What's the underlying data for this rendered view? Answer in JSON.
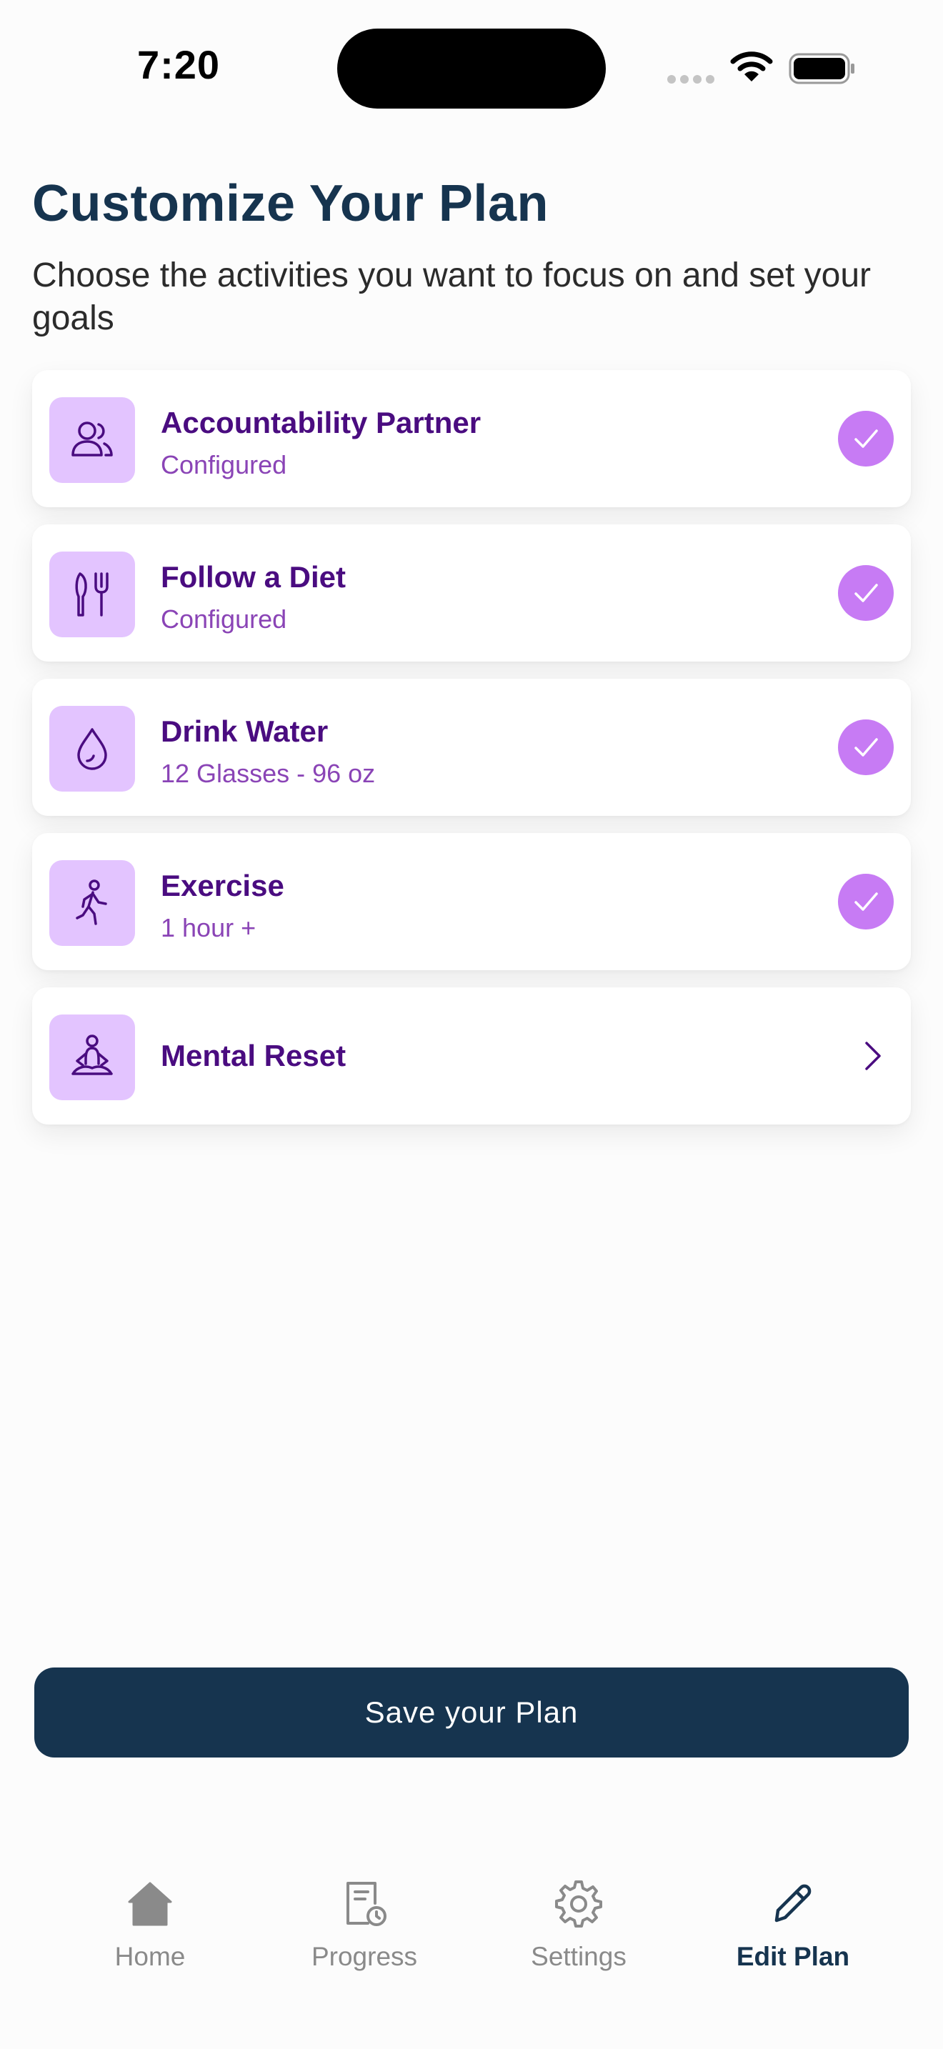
{
  "status_bar": {
    "time": "7:20"
  },
  "header": {
    "title": "Customize Your Plan",
    "subtitle": "Choose the activities you want to focus on and set your goals"
  },
  "activities": [
    {
      "title": "Accountability Partner",
      "subtitle": "Configured",
      "icon": "people-icon",
      "state": "checked"
    },
    {
      "title": "Follow a Diet",
      "subtitle": "Configured",
      "icon": "utensils-icon",
      "state": "checked"
    },
    {
      "title": "Drink Water",
      "subtitle": "12 Glasses - 96 oz",
      "icon": "water-drop-icon",
      "state": "checked"
    },
    {
      "title": "Exercise",
      "subtitle": "1 hour +",
      "icon": "walking-person-icon",
      "state": "checked"
    },
    {
      "title": "Mental Reset",
      "subtitle": "",
      "icon": "meditation-icon",
      "state": "chevron"
    }
  ],
  "save_button": {
    "label": "Save your Plan"
  },
  "tab_bar": {
    "tabs": [
      {
        "label": "Home",
        "icon": "home-icon",
        "active": false
      },
      {
        "label": "Progress",
        "icon": "progress-document-icon",
        "active": false
      },
      {
        "label": "Settings",
        "icon": "gear-icon",
        "active": false
      },
      {
        "label": "Edit Plan",
        "icon": "pencil-icon",
        "active": true
      }
    ]
  },
  "colors": {
    "navy": "#16344f",
    "purple_text": "#4a0c80",
    "purple_sub": "#8a44b6",
    "icon_bg": "#e3c4ff",
    "check_bg": "#c77bf4",
    "background": "#fcfcfc"
  }
}
